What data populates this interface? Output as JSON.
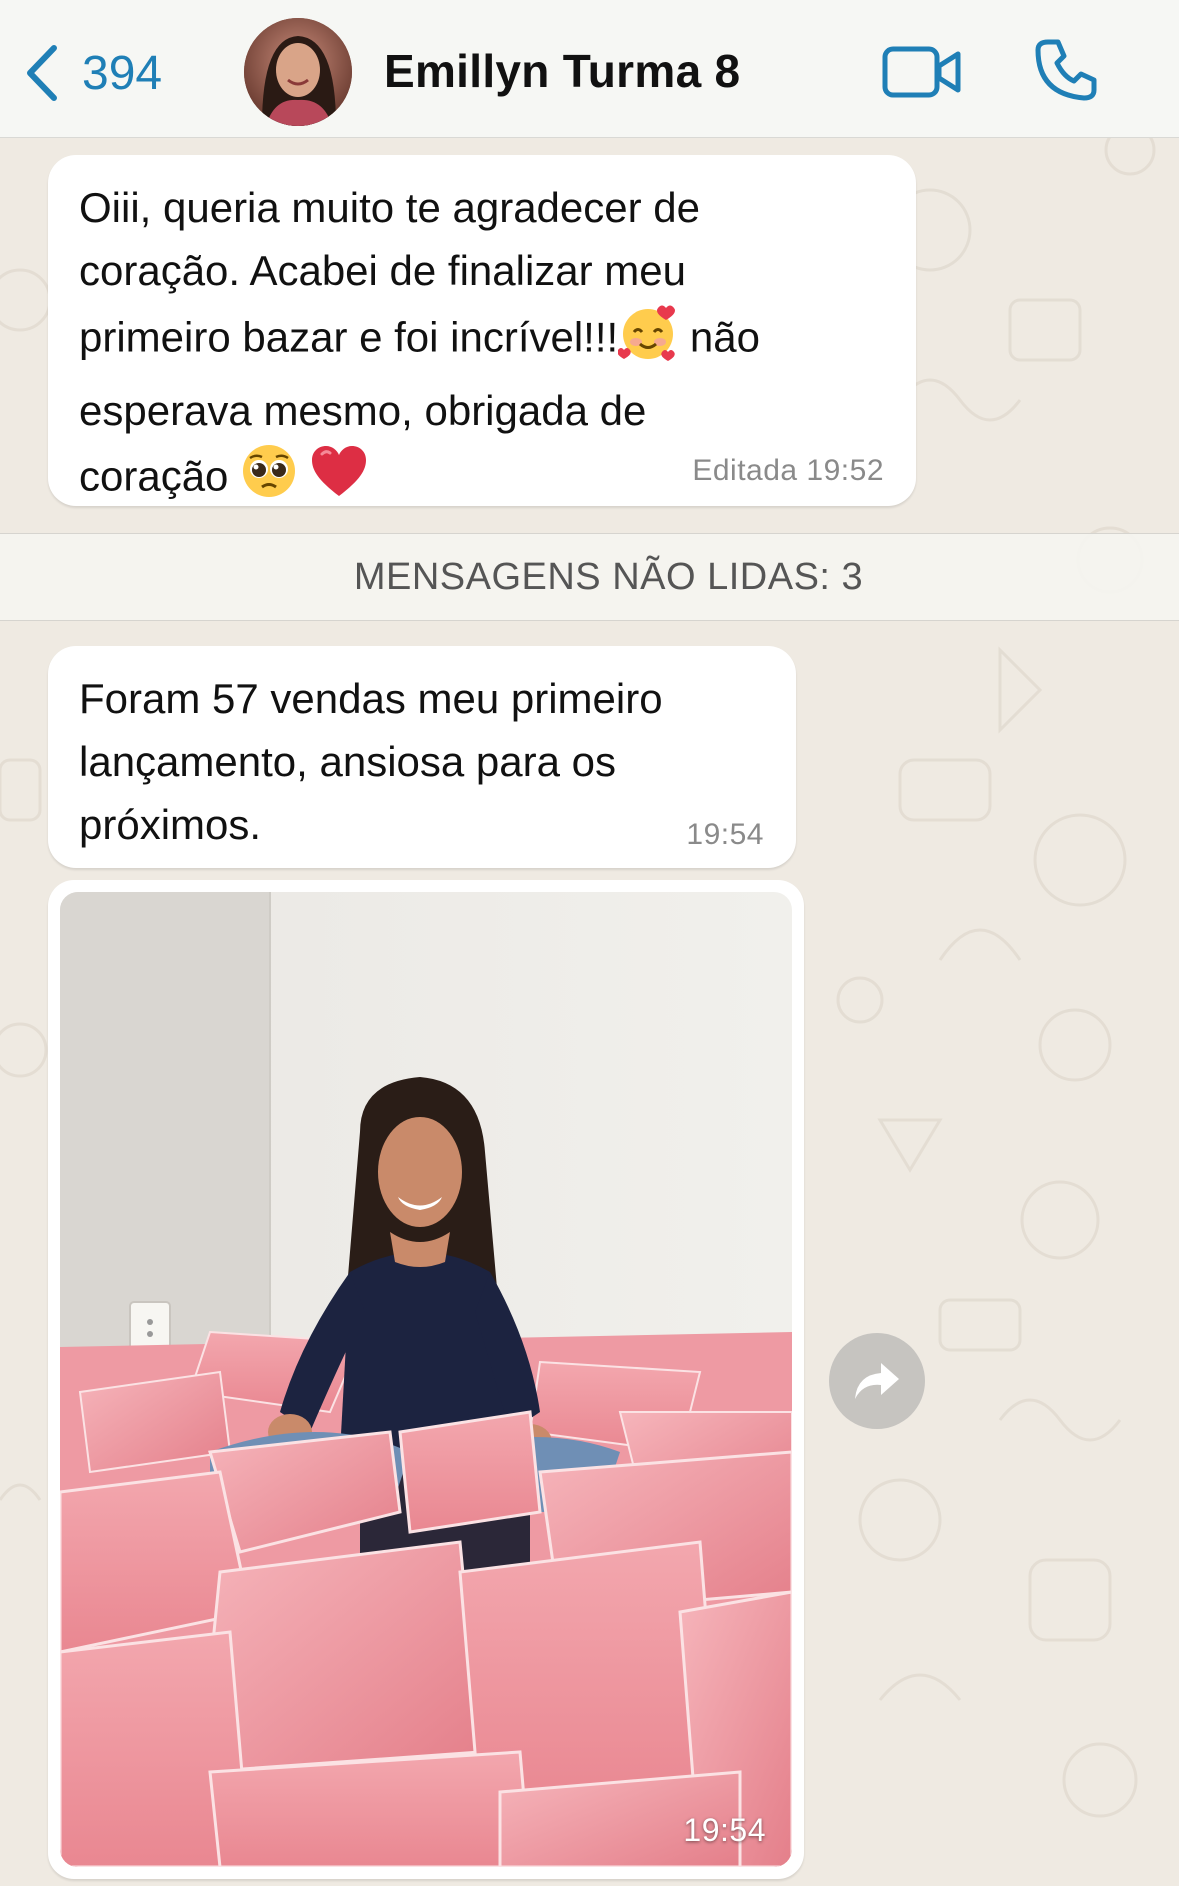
{
  "header": {
    "back_count": "394",
    "contact_name": "Emillyn Turma 8",
    "back_icon": "chevron-left-icon",
    "video_icon": "video-call-icon",
    "call_icon": "phone-icon"
  },
  "messages": [
    {
      "text_lines": [
        "Oiii, queria muito te agradecer de",
        "coração. Acabei de finalizar meu",
        "primeiro bazar e foi incrível!!!",
        " não",
        "esperava mesmo, obrigada de",
        "coração"
      ],
      "emojis": [
        "smiling-face-with-hearts",
        "pleading-face",
        "red-heart"
      ],
      "meta": "Editada 19:52"
    },
    {
      "text": "Foram 57 vendas meu primeiro\nlançamento, ansiosa para os\npróximos.",
      "meta": "19:54"
    }
  ],
  "divider": {
    "label": "MENSAGENS NÃO LIDAS: 3"
  },
  "photo_message": {
    "time": "19:54",
    "forward_icon": "forward-arrow-icon"
  },
  "colors": {
    "accent": "#1f7fb6",
    "chat_background": "#efeae2",
    "bubble": "#ffffff",
    "header": "#f6f7f4"
  }
}
